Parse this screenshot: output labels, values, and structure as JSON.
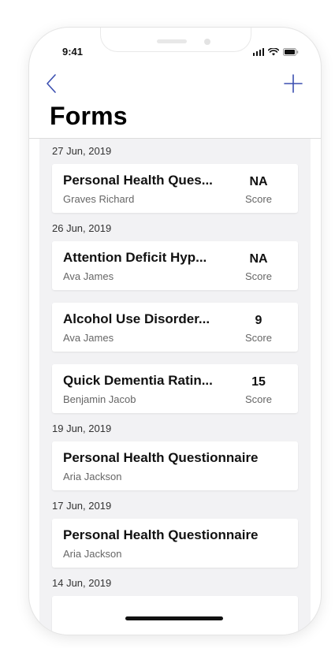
{
  "status_bar": {
    "time": "9:41",
    "icons": [
      "signal-icon",
      "wifi-icon",
      "battery-icon"
    ]
  },
  "nav": {
    "back_icon": "chevron-left-icon",
    "add_icon": "plus-icon"
  },
  "colors": {
    "accent": "#3b4fb0",
    "list_background": "#f2f2f4",
    "card_background": "#ffffff"
  },
  "page": {
    "title": "Forms"
  },
  "groups": [
    {
      "date": "27 Jun, 2019",
      "items": [
        {
          "title": "Personal Health Ques...",
          "name": "Graves Richard",
          "score": "NA",
          "score_label": "Score"
        }
      ]
    },
    {
      "date": "26 Jun, 2019",
      "items": [
        {
          "title": "Attention Deficit Hyp...",
          "name": "Ava James",
          "score": "NA",
          "score_label": "Score"
        },
        {
          "title": "Alcohol Use Disorder...",
          "name": "Ava James",
          "score": "9",
          "score_label": "Score"
        },
        {
          "title": "Quick Dementia Ratin...",
          "name": "Benjamin Jacob",
          "score": "15",
          "score_label": "Score"
        }
      ]
    },
    {
      "date": "19 Jun, 2019",
      "items": [
        {
          "title": "Personal Health Questionnaire",
          "name": "Aria Jackson"
        }
      ]
    },
    {
      "date": "17 Jun, 2019",
      "items": [
        {
          "title": "Personal Health Questionnaire",
          "name": "Aria Jackson"
        }
      ]
    },
    {
      "date": "14 Jun, 2019",
      "items": []
    }
  ]
}
